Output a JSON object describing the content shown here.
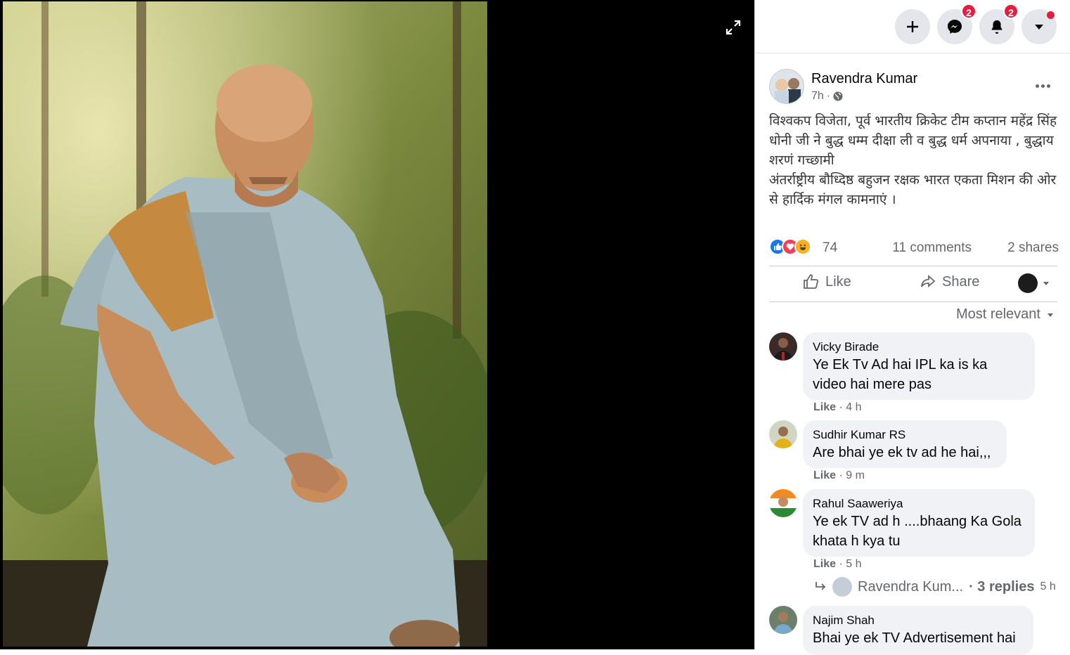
{
  "post": {
    "author": "Ravendra Kumar",
    "time": "7h",
    "separator": "·",
    "text": "विश्वकप विजेता, पूर्व भारतीय क्रिकेट टीम कप्तान महेंद्र सिंह धोनी जी ने बुद्ध धम्म दीक्षा ली व बुद्ध धर्म अपनाया , बुद्धाय शरणं गच्छामी\nअंतर्राष्ट्रीय बौध्दिष्ठ बहुजन रक्षक भारत एकता मिशन की ओर से हार्दिक मंगल कामनाएं ।",
    "reaction_count": "74",
    "comments_label": "11 comments",
    "shares_label": "2 shares"
  },
  "topbar": {
    "messenger_badge": "2",
    "notifications_badge": "2"
  },
  "actions": {
    "like": "Like",
    "share": "Share"
  },
  "sort": {
    "label": "Most relevant"
  },
  "comments": [
    {
      "name": "Vicky Birade",
      "text_line1": "Ye Ek Tv Ad hai IPL ka is ka",
      "text_line2": "video hai mere pas",
      "like": "Like",
      "time": "4 h"
    },
    {
      "name": "Sudhir Kumar RS",
      "text_line1": "Are bhai ye ek tv ad he hai,,,",
      "like": "Like",
      "time": "9 m"
    },
    {
      "name": "Rahul Saaweriya",
      "text_line1": "Ye ek TV ad h ....bhaang Ka Gola",
      "text_line2": "khata h kya tu",
      "like": "Like",
      "time": "5 h"
    },
    {
      "name": "Najim Shah",
      "text_line1": "Bhai ye ek TV Advertisement hai"
    }
  ],
  "reply_preview": {
    "author": "Ravendra Kum...",
    "replies": "· 3 replies",
    "time": "5 h"
  },
  "colors": {
    "badge": "#e41e3f",
    "like_blue": "#1877f2",
    "heart_red": "#f33e58",
    "haha_yellow": "#f7b125"
  },
  "icons": [
    "expand-icon",
    "plus-icon",
    "messenger-icon",
    "bell-icon",
    "caret-down-icon",
    "globe-icon",
    "thumbs-up-icon",
    "share-icon",
    "reply-arrow-icon"
  ]
}
